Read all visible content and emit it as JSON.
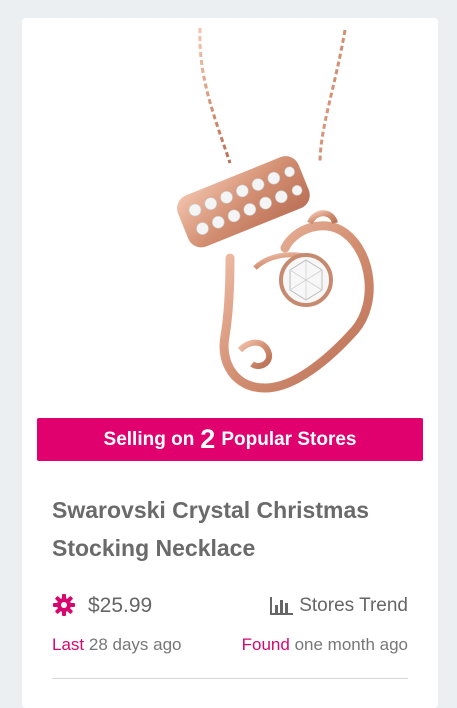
{
  "product": {
    "image_alt": "rose gold stocking pendant necklace",
    "banner": {
      "prefix": "Selling on",
      "count": "2",
      "suffix": "Popular Stores"
    },
    "title": "Swarovski Crystal Christmas Stocking Necklace",
    "price": "$25.99",
    "trend_label": "Stores Trend",
    "last": {
      "label": "Last",
      "value": "28 days ago"
    },
    "found": {
      "label": "Found",
      "value": "one month ago"
    }
  },
  "colors": {
    "accent": "#e0006e",
    "background": "#eceff2",
    "text": "#6a6a6a"
  },
  "icons": {
    "price": "gear-icon",
    "trend": "bar-chart-icon"
  }
}
